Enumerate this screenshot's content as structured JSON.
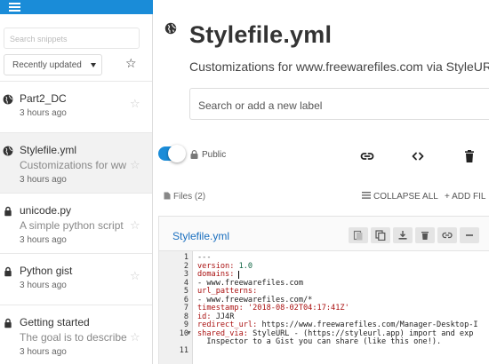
{
  "sidebar": {
    "search_placeholder": "Search snippets",
    "sort_label": "Recently updated",
    "snippets": [
      {
        "title": "Part2_DC",
        "desc": "",
        "time": "3 hours ago",
        "icon": "globe-icon",
        "visibility": "public"
      },
      {
        "title": "Stylefile.yml",
        "desc": "Customizations for ww",
        "time": "3 hours ago",
        "icon": "globe-icon",
        "visibility": "public",
        "selected": true
      },
      {
        "title": "unicode.py",
        "desc": "A simple python script",
        "time": "3 hours ago",
        "icon": "lock-icon",
        "visibility": "private"
      },
      {
        "title": "Python gist",
        "desc": "",
        "time": "3 hours ago",
        "icon": "lock-icon",
        "visibility": "private"
      },
      {
        "title": "Getting started",
        "desc": "The goal is to describe",
        "time": "3 hours ago",
        "icon": "lock-icon",
        "visibility": "private"
      }
    ]
  },
  "main": {
    "title": "Stylefile.yml",
    "description": "Customizations for www.freewarefiles.com via StyleURL",
    "label_placeholder": "Search or add a new label",
    "visibility_label": "Public",
    "files_label": "Files (2)",
    "collapse_all": "COLLAPSE ALL",
    "add_file": "+ ADD FIL",
    "file_name": "Stylefile.yml"
  },
  "code": {
    "line_numbers": [
      "1",
      "2",
      "3",
      "4",
      "5",
      "6",
      "7",
      "8",
      "9",
      "10",
      "",
      "11"
    ],
    "lines": [
      [
        {
          "t": "---",
          "c": "o"
        }
      ],
      [
        {
          "t": "version: ",
          "c": "k"
        },
        {
          "t": "1.0",
          "c": "n"
        }
      ],
      [
        {
          "t": "domains:",
          "c": "k"
        }
      ],
      [
        {
          "t": "- www.freewarefiles.com",
          "c": "p"
        }
      ],
      [
        {
          "t": "url_patterns:",
          "c": "k"
        }
      ],
      [
        {
          "t": "- www.freewarefiles.com/*",
          "c": "p"
        }
      ],
      [
        {
          "t": "timestamp: ",
          "c": "k"
        },
        {
          "t": "'2018-08-02T04:17:41Z'",
          "c": "s"
        }
      ],
      [
        {
          "t": "id: ",
          "c": "k"
        },
        {
          "t": "JJ4R",
          "c": "p"
        }
      ],
      [
        {
          "t": "redirect_url: ",
          "c": "k"
        },
        {
          "t": "https://www.freewarefiles.com/Manager-Desktop-I",
          "c": "p"
        }
      ],
      [
        {
          "t": "shared_via: ",
          "c": "k"
        },
        {
          "t": "StyleURL - (https://styleurl.app) import and exp",
          "c": "p"
        }
      ],
      [
        {
          "t": "  Inspector to a Gist you can share (like this one!).",
          "c": "p"
        }
      ],
      [
        {
          "t": "",
          "c": "p"
        }
      ]
    ]
  },
  "colors": {
    "accent": "#1a8cd8",
    "link": "#1a6fbf"
  }
}
